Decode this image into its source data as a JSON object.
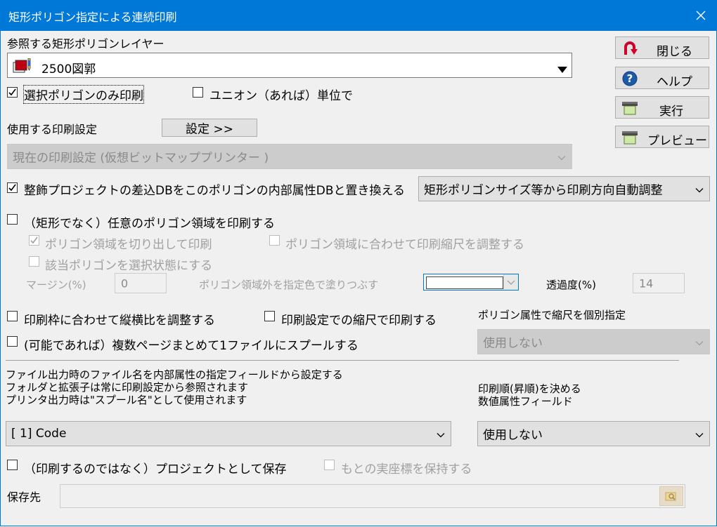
{
  "window": {
    "title": "矩形ポリゴン指定による連続印刷"
  },
  "layer": {
    "label": "参照する矩形ポリゴンレイヤー",
    "value": "2500図郭",
    "icon": "layer-icon"
  },
  "buttons": {
    "close": "閉じる",
    "help": "ヘルプ",
    "execute": "実行",
    "preview": "プレビュー"
  },
  "selected_only": {
    "label": "選択ポリゴンのみ印刷",
    "checked": true
  },
  "union": {
    "label": "ユニオン（あれば）単位で",
    "checked": false
  },
  "print_settings": {
    "label": "使用する印刷設定",
    "button": "設定 >>",
    "value": "現在の印刷設定 (仮想ビットマッププリンター )"
  },
  "replace_db": {
    "label": "整飾プロジェクトの差込DBをこのポリゴンの内部属性DBと置き換える",
    "checked": true
  },
  "orientation": {
    "value": "矩形ポリゴンサイズ等から印刷方向自動調整"
  },
  "any_polygon": {
    "label": "（矩形でなく）任意のポリゴン領域を印刷する",
    "checked": false
  },
  "clip_polygon": {
    "label": "ポリゴン領域を切り出して印刷",
    "checked": true
  },
  "fit_scale": {
    "label": "ポリゴン領域に合わせて印刷縮尺を調整する",
    "checked": false
  },
  "select_state": {
    "label": "該当ポリゴンを選択状態にする",
    "checked": false
  },
  "margin": {
    "label": "マージン(%)",
    "value": "0"
  },
  "fill_outside": {
    "label": "ポリゴン領域外を指定色で塗りつぶす",
    "color": "#ffffff"
  },
  "transparency": {
    "label": "透過度(%)",
    "value": "14"
  },
  "aspect": {
    "label": "印刷枠に合わせて縦横比を調整する",
    "checked": false
  },
  "print_scale": {
    "label": "印刷設定での縮尺で印刷する",
    "checked": false
  },
  "scale_attr": {
    "label": "ポリゴン属性で縮尺を個別指定",
    "value": "使用しない"
  },
  "spool": {
    "label": "(可能であれば）複数ページまとめて1ファイルにスプールする",
    "checked": false
  },
  "filename_info": {
    "line1": "ファイル出力時のファイル名を内部属性の指定フィールドから設定する",
    "line2": "フォルダと拡張子は常に印刷設定から参照されます",
    "line3": "プリンタ出力時は\"スプール名\"として使用されます"
  },
  "filename_field": {
    "value": "[ 1] Code"
  },
  "order_field": {
    "label1": "印刷順(昇順)を決める",
    "label2": "数値属性フィールド",
    "value": "使用しない"
  },
  "save_project": {
    "label": "（印刷するのではなく）プロジェクトとして保存",
    "checked": false
  },
  "keep_coords": {
    "label": "もとの実座標を保持する",
    "checked": false
  },
  "save_to": {
    "label": "保存先",
    "value": ""
  }
}
